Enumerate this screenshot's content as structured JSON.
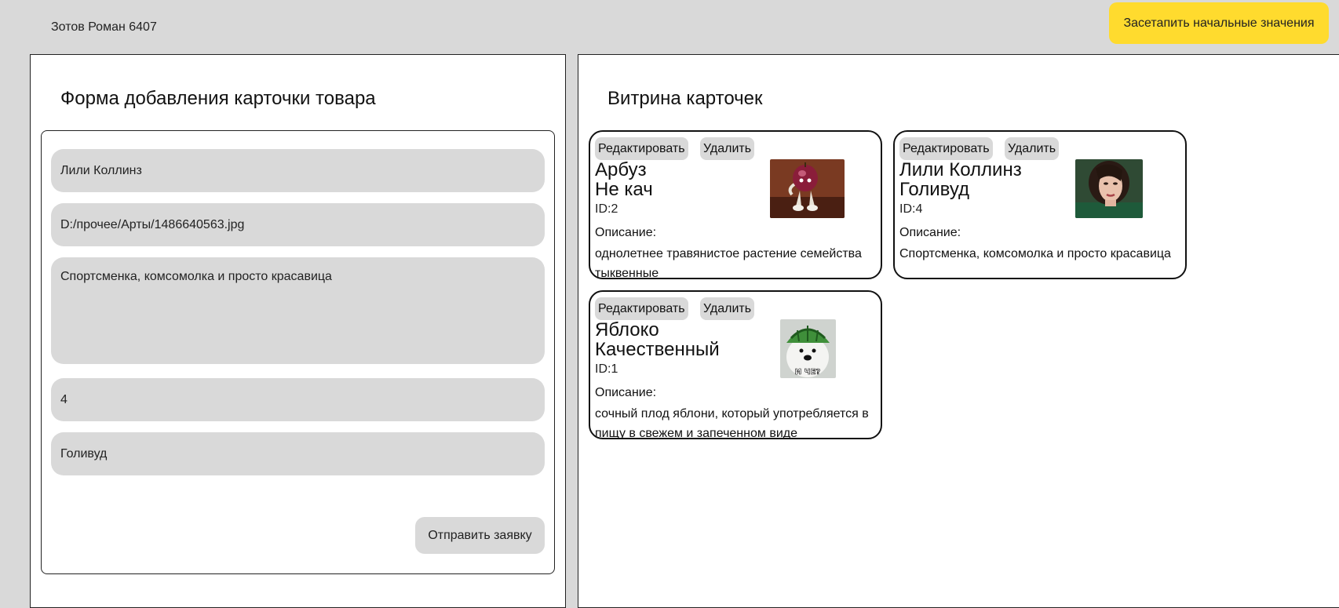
{
  "header": {
    "author": "Зотов Роман 6407",
    "reset_button": "Засетапить начальные значения"
  },
  "form_panel": {
    "title": "Форма добавления карточки товара",
    "fields": {
      "name": "Лили Коллинз",
      "image_path": "D:/прочее/Арты/1486640563.jpg",
      "description": "Спортсменка, комсомолка и просто красавица",
      "id": "4",
      "category": "Голивуд"
    },
    "submit_button": "Отправить заявку"
  },
  "showcase": {
    "title": "Витрина карточек",
    "edit_label": "Редактировать",
    "delete_label": "Удалить",
    "desc_label": "Описание:",
    "cards": [
      {
        "name": "Арбуз",
        "category": "Не кач",
        "id": "ID:2",
        "description": "однолетнее травянистое растение семейства тыквенные",
        "image": "cartoon-plum-character"
      },
      {
        "name": "Лили Коллинз",
        "category": "Голивуд",
        "id": "ID:4",
        "description": "Спортсменка, комсомолка и просто красавица",
        "image": "woman-portrait"
      },
      {
        "name": "Яблоко",
        "category": "Качественный",
        "id": "ID:1",
        "description": "сочный плод яблони, который употребляется в пищу в свежем и запеченном виде",
        "image": "dog-watermelon-helmet-meme",
        "image_caption": "И ЧЕ?"
      }
    ]
  },
  "colors": {
    "background": "#d9d9d9",
    "accent_button": "#ffdb2e",
    "panel": "#ffffff",
    "field": "#d9d9d9"
  }
}
